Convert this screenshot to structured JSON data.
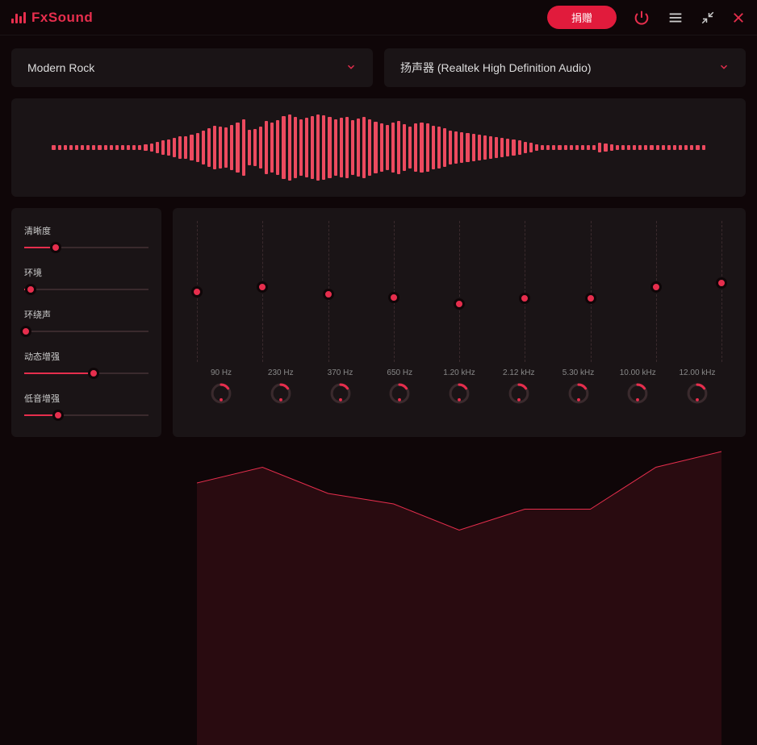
{
  "app_name": "FxSound",
  "toolbar": {
    "donate_label": "捐赠"
  },
  "preset_dropdown": {
    "value": "Modern Rock"
  },
  "output_dropdown": {
    "value": "扬声器 (Realtek High Definition Audio)"
  },
  "sliders": [
    {
      "label": "清晰度",
      "value": 25
    },
    {
      "label": "环境",
      "value": 5
    },
    {
      "label": "环绕声",
      "value": 1
    },
    {
      "label": "动态增强",
      "value": 56
    },
    {
      "label": "低音增强",
      "value": 27
    }
  ],
  "eq": {
    "freqs": [
      "90 Hz",
      "230 Hz",
      "370 Hz",
      "650 Hz",
      "1.20 kHz",
      "2.12 kHz",
      "5.30 kHz",
      "10.00 kHz",
      "12.00 kHz"
    ],
    "values": [
      50,
      47,
      52,
      54,
      59,
      55,
      55,
      47,
      44
    ]
  },
  "spectrum": [
    6,
    6,
    6,
    6,
    6,
    6,
    6,
    6,
    6,
    6,
    6,
    6,
    6,
    6,
    6,
    6,
    8,
    10,
    14,
    18,
    20,
    24,
    28,
    28,
    32,
    36,
    42,
    48,
    54,
    52,
    50,
    56,
    62,
    70,
    44,
    46,
    52,
    66,
    62,
    68,
    78,
    82,
    76,
    70,
    74,
    78,
    82,
    80,
    76,
    70,
    74,
    76,
    68,
    72,
    76,
    70,
    64,
    60,
    56,
    62,
    66,
    58,
    52,
    60,
    62,
    60,
    54,
    52,
    48,
    42,
    40,
    38,
    36,
    34,
    32,
    30,
    28,
    26,
    24,
    22,
    20,
    18,
    14,
    12,
    8,
    6,
    6,
    6,
    6,
    6,
    6,
    6,
    6,
    6,
    6,
    12,
    10,
    8,
    6,
    6,
    6,
    6,
    6,
    6,
    6,
    6,
    6,
    6,
    6,
    6,
    6,
    6,
    6,
    6
  ]
}
